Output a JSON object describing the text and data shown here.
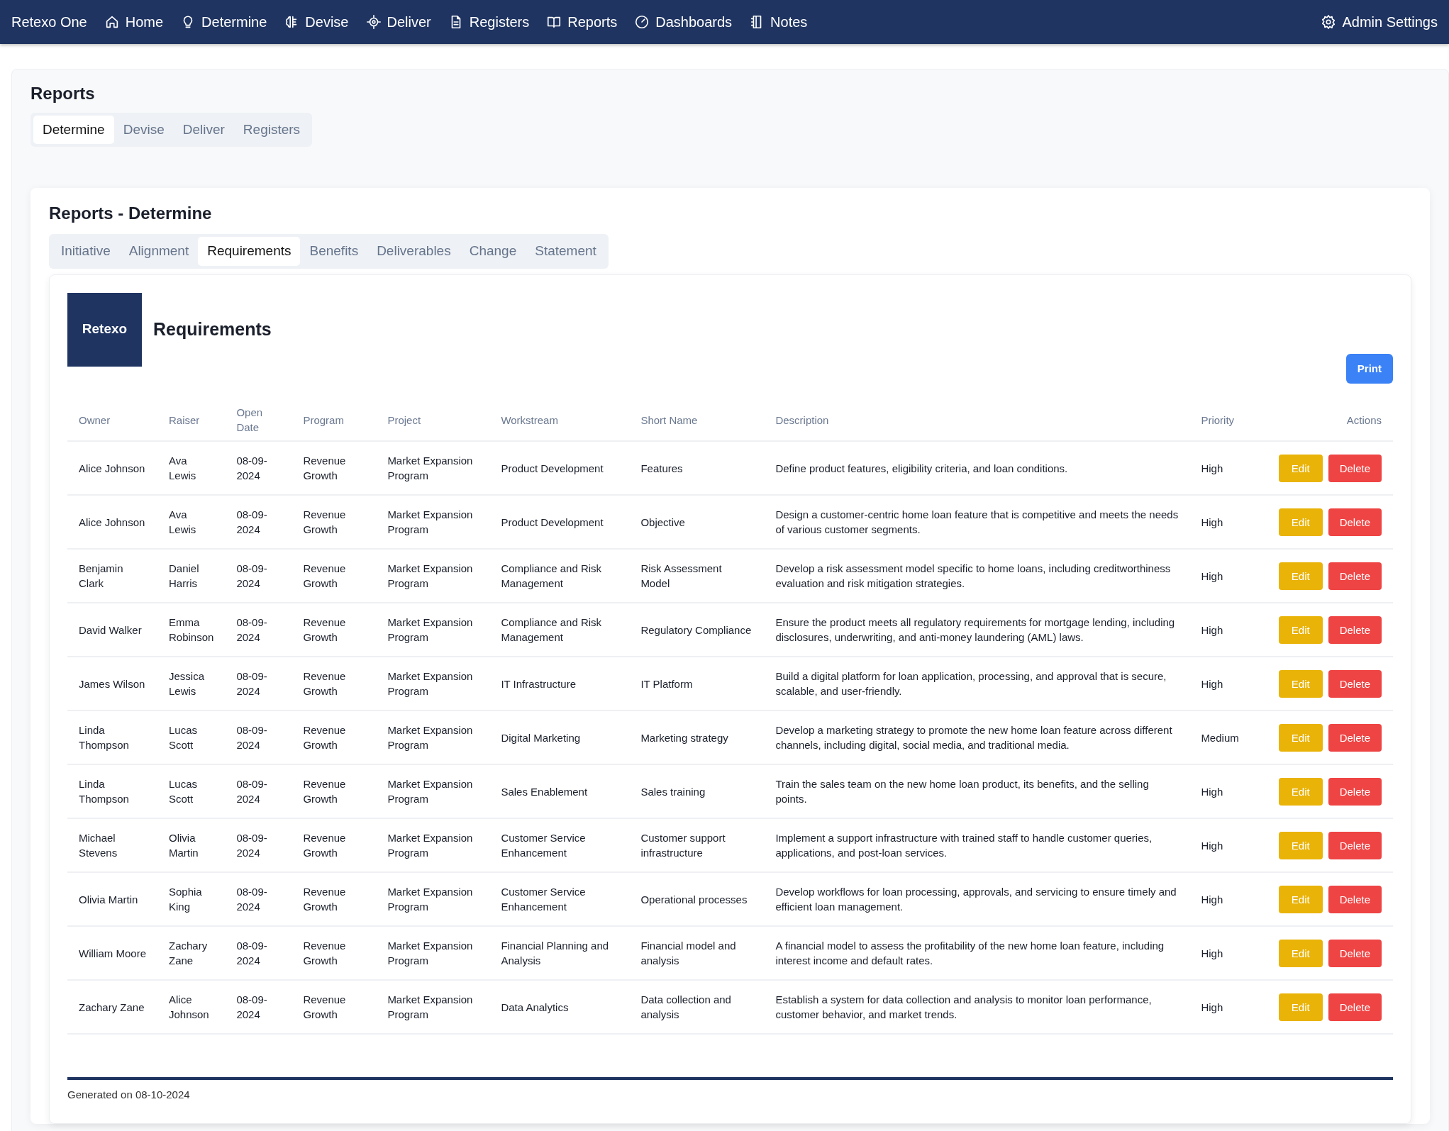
{
  "navbar": {
    "brand": "Retexo One",
    "items": [
      {
        "label": "Home"
      },
      {
        "label": "Determine"
      },
      {
        "label": "Devise"
      },
      {
        "label": "Deliver"
      },
      {
        "label": "Registers"
      },
      {
        "label": "Reports"
      },
      {
        "label": "Dashboards"
      },
      {
        "label": "Notes"
      }
    ],
    "settings": "Admin Settings"
  },
  "page": {
    "title": "Reports",
    "tabs": [
      {
        "label": "Determine",
        "selected": true
      },
      {
        "label": "Devise",
        "selected": false
      },
      {
        "label": "Deliver",
        "selected": false
      },
      {
        "label": "Registers",
        "selected": false
      }
    ]
  },
  "section": {
    "title": "Reports - Determine",
    "tabs": [
      {
        "label": "Initiative",
        "selected": false
      },
      {
        "label": "Alignment",
        "selected": false
      },
      {
        "label": "Requirements",
        "selected": true
      },
      {
        "label": "Benefits",
        "selected": false
      },
      {
        "label": "Deliverables",
        "selected": false
      },
      {
        "label": "Change",
        "selected": false
      },
      {
        "label": "Statement",
        "selected": false
      }
    ]
  },
  "report": {
    "logo": "Retexo",
    "title": "Requirements",
    "print": "Print",
    "footer": "Generated on 08-10-2024",
    "table": {
      "columns": [
        "Owner",
        "Raiser",
        "Open Date",
        "Program",
        "Project",
        "Workstream",
        "Short Name",
        "Description",
        "Priority",
        "Actions"
      ],
      "rows": [
        {
          "cells": [
            "Alice Johnson",
            "Ava Lewis",
            "08-09-2024",
            "Revenue Growth",
            "Market Expansion Program",
            "Product Development",
            "Features",
            "Define product features, eligibility criteria, and loan conditions.",
            "High"
          ],
          "actions": [
            "Edit",
            "Delete"
          ]
        },
        {
          "cells": [
            "Alice Johnson",
            "Ava Lewis",
            "08-09-2024",
            "Revenue Growth",
            "Market Expansion Program",
            "Product Development",
            "Objective",
            "Design a customer-centric home loan feature that is competitive and meets the needs of various customer segments.",
            "High"
          ],
          "actions": [
            "Edit",
            "Delete"
          ]
        },
        {
          "cells": [
            "Benjamin Clark",
            "Daniel Harris",
            "08-09-2024",
            "Revenue Growth",
            "Market Expansion Program",
            "Compliance and Risk Management",
            "Risk Assessment Model",
            "Develop a risk assessment model specific to home loans, including creditworthiness evaluation and risk mitigation strategies.",
            "High"
          ],
          "actions": [
            "Edit",
            "Delete"
          ]
        },
        {
          "cells": [
            "David Walker",
            "Emma Robinson",
            "08-09-2024",
            "Revenue Growth",
            "Market Expansion Program",
            "Compliance and Risk Management",
            "Regulatory Compliance",
            "Ensure the product meets all regulatory requirements for mortgage lending, including disclosures, underwriting, and anti-money laundering (AML) laws.",
            "High"
          ],
          "actions": [
            "Edit",
            "Delete"
          ]
        },
        {
          "cells": [
            "James Wilson",
            "Jessica Lewis",
            "08-09-2024",
            "Revenue Growth",
            "Market Expansion Program",
            "IT Infrastructure",
            "IT Platform",
            "Build a digital platform for loan application, processing, and approval that is secure, scalable, and user-friendly.",
            "High"
          ],
          "actions": [
            "Edit",
            "Delete"
          ]
        },
        {
          "cells": [
            "Linda Thompson",
            "Lucas Scott",
            "08-09-2024",
            "Revenue Growth",
            "Market Expansion Program",
            "Digital Marketing",
            "Marketing strategy",
            "Develop a marketing strategy to promote the new home loan feature across different channels, including digital, social media, and traditional media.",
            "Medium"
          ],
          "actions": [
            "Edit",
            "Delete"
          ]
        },
        {
          "cells": [
            "Linda Thompson",
            "Lucas Scott",
            "08-09-2024",
            "Revenue Growth",
            "Market Expansion Program",
            "Sales Enablement",
            "Sales training",
            "Train the sales team on the new home loan product, its benefits, and the selling points.",
            "High"
          ],
          "actions": [
            "Edit",
            "Delete"
          ]
        },
        {
          "cells": [
            "Michael Stevens",
            "Olivia Martin",
            "08-09-2024",
            "Revenue Growth",
            "Market Expansion Program",
            "Customer Service Enhancement",
            "Customer support infrastructure",
            "Implement a support infrastructure with trained staff to handle customer queries, applications, and post-loan services.",
            "High"
          ],
          "actions": [
            "Edit",
            "Delete"
          ]
        },
        {
          "cells": [
            "Olivia Martin",
            "Sophia King",
            "08-09-2024",
            "Revenue Growth",
            "Market Expansion Program",
            "Customer Service Enhancement",
            "Operational processes",
            "Develop workflows for loan processing, approvals, and servicing to ensure timely and efficient loan management.",
            "High"
          ],
          "actions": [
            "Edit",
            "Delete"
          ]
        },
        {
          "cells": [
            "William Moore",
            "Zachary Zane",
            "08-09-2024",
            "Revenue Growth",
            "Market Expansion Program",
            "Financial Planning and Analysis",
            "Financial model and analysis",
            "A financial model to assess the profitability of the new home loan feature, including interest income and default rates.",
            "High"
          ],
          "actions": [
            "Edit",
            "Delete"
          ]
        },
        {
          "cells": [
            "Zachary Zane",
            "Alice Johnson",
            "08-09-2024",
            "Revenue Growth",
            "Market Expansion Program",
            "Data Analytics",
            "Data collection and analysis",
            "Establish a system for data collection and analysis to monitor loan performance, customer behavior, and market trends.",
            "High"
          ],
          "actions": [
            "Edit",
            "Delete"
          ]
        }
      ]
    }
  }
}
